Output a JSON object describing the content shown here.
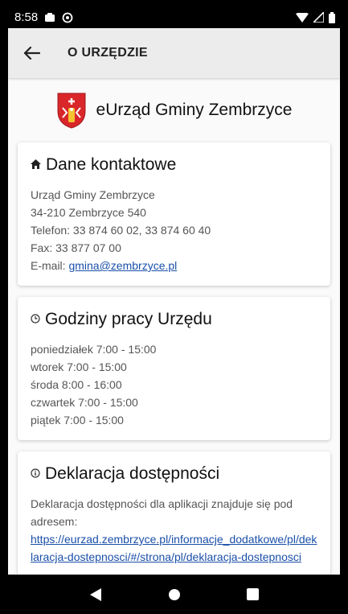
{
  "status": {
    "time": "8:58"
  },
  "appbar": {
    "title": "O URZĘDZIE"
  },
  "brand": {
    "name": "eUrząd Gminy Zembrzyce"
  },
  "contact": {
    "title": "Dane kontaktowe",
    "lines": [
      "Urząd Gminy Zembrzyce",
      "34-210 Zembrzyce 540",
      "Telefon: 33 874 60 02, 33 874 60 40",
      "Fax: 33 877 07 00"
    ],
    "email_label": "E-mail: ",
    "email": "gmina@zembrzyce.pl"
  },
  "hours": {
    "title": "Godziny pracy Urzędu",
    "lines": [
      "poniedziałek 7:00 - 15:00",
      "wtorek 7:00 - 15:00",
      "środa 8:00 - 16:00",
      "czwartek 7:00 - 15:00",
      "piątek 7:00 - 15:00"
    ]
  },
  "accessibility": {
    "title": "Deklaracja dostępności",
    "text": "Deklaracja dostępności dla aplikacji znajduje się pod adresem:",
    "link": "https://eurzad.zembrzyce.pl/informacje_dodatkowe/pl/deklaracja-dostepnosci/#/strona/pl/deklaracja-dostepnosci"
  },
  "colors": {
    "link": "#1a4fa8",
    "appbar": "#ececec",
    "background": "#fafafa"
  }
}
